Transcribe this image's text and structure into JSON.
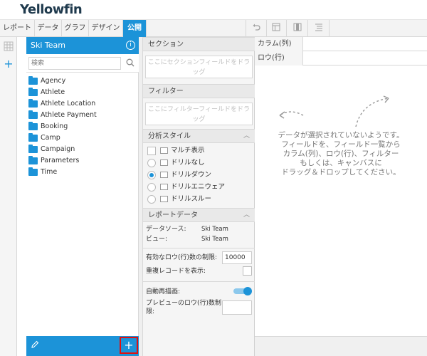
{
  "app": {
    "logo": "Yellowfin"
  },
  "menu": {
    "tabs": [
      {
        "label": "レポート"
      },
      {
        "label": "データ"
      },
      {
        "label": "グラフ"
      },
      {
        "label": "デザイン"
      },
      {
        "label": "公開"
      }
    ],
    "active_tab": "公開"
  },
  "toolbar": {
    "icons": [
      "undo-icon",
      "table-icon",
      "columns-icon",
      "list-icon"
    ]
  },
  "left_panel": {
    "title": "Ski Team",
    "search_placeholder": "検索",
    "folders": [
      {
        "label": "Agency"
      },
      {
        "label": "Athlete"
      },
      {
        "label": "Athlete Location"
      },
      {
        "label": "Athlete Payment"
      },
      {
        "label": "Booking"
      },
      {
        "label": "Camp"
      },
      {
        "label": "Campaign"
      },
      {
        "label": "Parameters"
      },
      {
        "label": "Time"
      }
    ],
    "add_button": "+"
  },
  "middle_panel": {
    "section": {
      "header": "セクション",
      "placeholder": "ここにセクションフィールドをドラッグ"
    },
    "filter": {
      "header": "フィルター",
      "placeholder": "ここにフィルターフィールドをドラッグ"
    },
    "analysis_style": {
      "header": "分析スタイル",
      "options": [
        {
          "label": "マルチ表示",
          "type": "checkbox",
          "selected": false
        },
        {
          "label": "ドリルなし",
          "type": "radio",
          "selected": false
        },
        {
          "label": "ドリルダウン",
          "type": "radio",
          "selected": true
        },
        {
          "label": "ドリルエニウェア",
          "type": "radio",
          "selected": false
        },
        {
          "label": "ドリルスルー",
          "type": "radio",
          "selected": false
        }
      ]
    },
    "report_data": {
      "header": "レポートデータ",
      "data_source_label": "データソース:",
      "data_source_value": "Ski Team",
      "view_label": "ビュー:",
      "view_value": "Ski Team",
      "row_limit_label": "有効なロウ(行)数の制限:",
      "row_limit_value": "10000",
      "duplicates_label": "重複レコードを表示:",
      "auto_refresh_label": "自動再描画:",
      "preview_limit_label_1": "プレビューのロウ(行)数制",
      "preview_limit_label_2": "限:"
    }
  },
  "canvas": {
    "column_label": "カラム(列)",
    "row_label": "ロウ(行)",
    "empty_message": [
      "データが選択されていないようです。",
      "フィールドを、フィールド一覧から",
      "カラム(列)、ロウ(行)、フィルター",
      "もしくは、キャンバスに",
      "ドラッグ＆ドロップしてください。"
    ]
  },
  "colors": {
    "accent": "#1c93d8",
    "highlight_border": "#e01010",
    "logo_yellow": "#f7b500"
  }
}
